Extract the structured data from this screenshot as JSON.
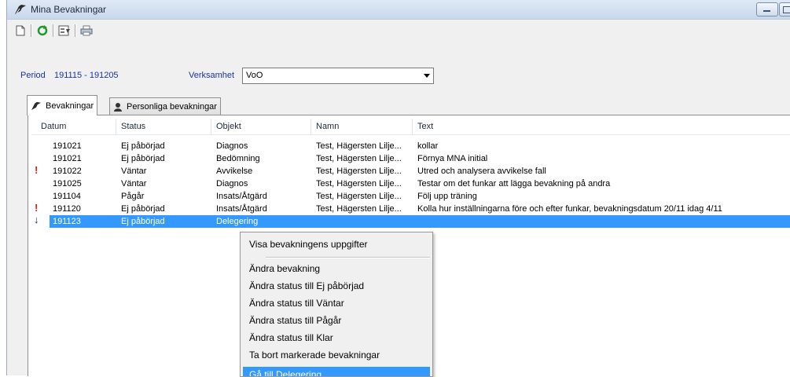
{
  "window": {
    "title": "Mina Bevakningar",
    "accent": "#3399ff"
  },
  "toolbar": {
    "items": [
      "new-document-icon",
      "refresh-icon",
      "properties-icon",
      "print-icon"
    ]
  },
  "filter": {
    "period_label": "Period",
    "period_value": "191115 - 191205",
    "verksamhet_label": "Verksamhet",
    "verksamhet_value": "VoO"
  },
  "tabs": [
    {
      "label": "Bevakningar",
      "active": true
    },
    {
      "label": "Personliga bevakningar",
      "active": false
    }
  ],
  "list": {
    "columns": [
      "Datum",
      "Status",
      "Objekt",
      "Namn",
      "Text"
    ],
    "rows": [
      {
        "flag": "",
        "datum": "191021",
        "status": "Ej påbörjad",
        "objekt": "Diagnos",
        "namn": "Test, Hägersten Lilje...",
        "text": "kollar"
      },
      {
        "flag": "",
        "datum": "191021",
        "status": "Ej påbörjad",
        "objekt": "Bedömning",
        "namn": "Test, Hägersten Lilje...",
        "text": "Förnya MNA initial"
      },
      {
        "flag": "!",
        "datum": "191022",
        "status": "Väntar",
        "objekt": "Avvikelse",
        "namn": "Test, Hägersten Lilje...",
        "text": "Utred och analysera avvikelse fall"
      },
      {
        "flag": "",
        "datum": "191025",
        "status": "Väntar",
        "objekt": "Diagnos",
        "namn": "Test, Hägersten Lilje...",
        "text": "Testar om det funkar att lägga bevakning på andra"
      },
      {
        "flag": "",
        "datum": "191104",
        "status": "Pågår",
        "objekt": "Insats/Åtgärd",
        "namn": "Test, Hägersten Lilje...",
        "text": "Följ upp träning"
      },
      {
        "flag": "!",
        "datum": "191120",
        "status": "Ej påbörjad",
        "objekt": "Insats/Åtgärd",
        "namn": "Test, Hägersten Lilje...",
        "text": "Kolla hur inställningarna före och efter funkar, bevakningsdatum 20/11 idag 4/11"
      },
      {
        "flag": "↓",
        "datum": "191123",
        "status": "Ej påbörjad",
        "objekt": "Delegering",
        "namn": "",
        "text": ""
      }
    ]
  },
  "context_menu": {
    "items": [
      "Visa bevakningens uppgifter",
      "Ändra bevakning",
      "Ändra status till Ej påbörjad",
      "Ändra status till Väntar",
      "Ändra status till Pågår",
      "Ändra status till Klar",
      "Ta bort markerade bevakningar",
      "Gå till Delegering"
    ]
  }
}
